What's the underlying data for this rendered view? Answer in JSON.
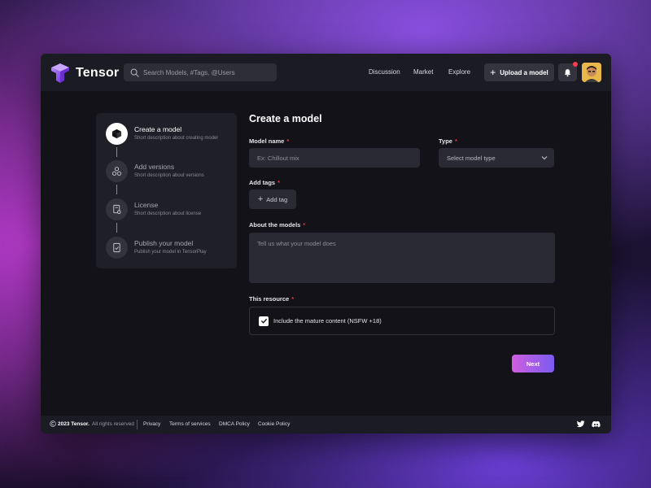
{
  "header": {
    "logo_text": "Tensor",
    "search_placeholder": "Search Models, #Tags, @Users",
    "nav": [
      "Discussion",
      "Market",
      "Explore"
    ],
    "upload_label": "Upload a model"
  },
  "steps": [
    {
      "title": "Create a model",
      "desc": "Short description about creating model",
      "icon": "cube-icon",
      "active": true
    },
    {
      "title": "Add versions",
      "desc": "Short description about versions",
      "icon": "versions-icon",
      "active": false
    },
    {
      "title": "License",
      "desc": "Short description about license",
      "icon": "license-icon",
      "active": false
    },
    {
      "title": "Publish your model",
      "desc": "Publish your model in TensorPlay",
      "icon": "publish-icon",
      "active": false
    }
  ],
  "form": {
    "title": "Create a model",
    "model_name_label": "Model name",
    "model_name_placeholder": "Ex: Chillout mix",
    "type_label": "Type",
    "type_placeholder": "Select model type",
    "tags_label": "Add tags",
    "add_tag_label": "Add tag",
    "about_label": "About the models",
    "about_placeholder": "Tell us what your model does",
    "resource_label": "This resource",
    "mature_checkbox_label": "Include the mature content (NSFW +18)",
    "mature_checked": true,
    "next_label": "Next"
  },
  "footer": {
    "copyright_year": "2023 Tensor.",
    "copyright_rest": "All rights reserved",
    "links": [
      "Privacy",
      "Terms of services",
      "DMCA Policy",
      "Cookie Policy"
    ]
  },
  "colors": {
    "accent_gradient_start": "#d05ee0",
    "accent_gradient_end": "#7a5cf0",
    "required": "#e03a4a",
    "notification_dot": "#ff3b4e"
  }
}
